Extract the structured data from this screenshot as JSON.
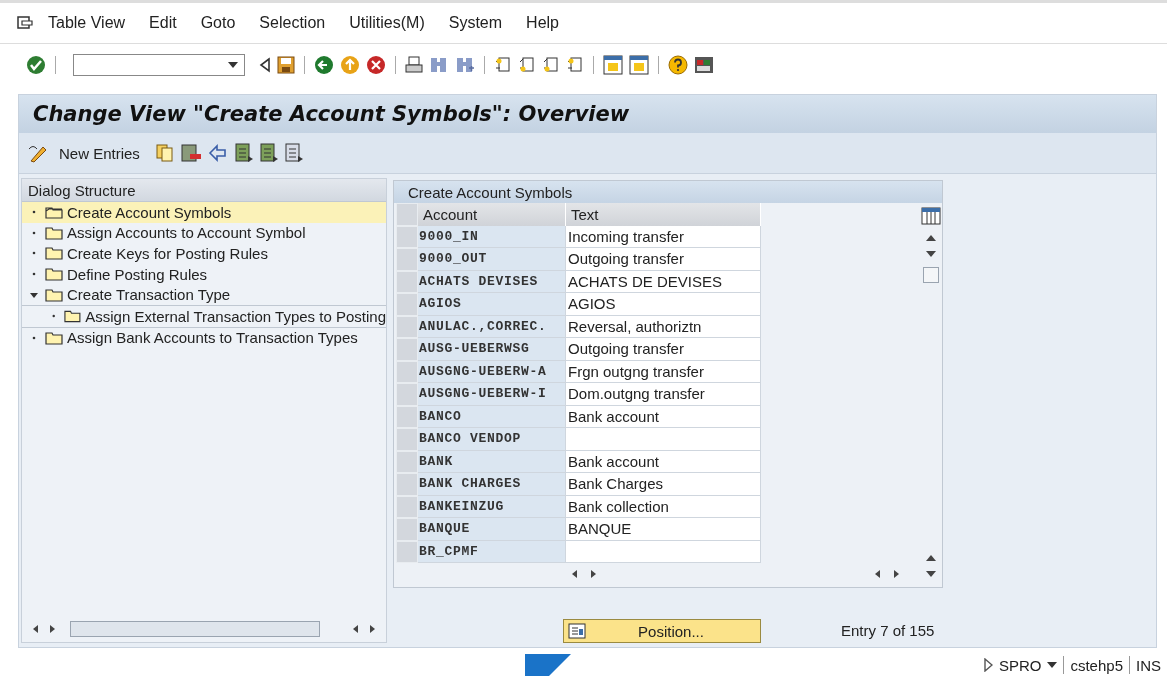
{
  "menu": [
    "Table View",
    "Edit",
    "Goto",
    "Selection",
    "Utilities(M)",
    "System",
    "Help"
  ],
  "title": "Change View \"Create Account Symbols\": Overview",
  "app_toolbar": {
    "new_entries": "New Entries"
  },
  "dialog_structure": {
    "heading": "Dialog Structure",
    "items": [
      {
        "label": "Create Account Symbols",
        "selected": true,
        "expanded": false
      },
      {
        "label": "Assign Accounts to Account Symbol",
        "selected": false,
        "expanded": false
      },
      {
        "label": "Create Keys for Posting Rules",
        "selected": false,
        "expanded": false
      },
      {
        "label": "Define Posting Rules",
        "selected": false,
        "expanded": false
      },
      {
        "label": "Create Transaction Type",
        "selected": false,
        "expanded": true,
        "children": [
          {
            "label": "Assign External Transaction Types to Posting",
            "selected": false,
            "expanded": false
          }
        ]
      },
      {
        "label": "Assign Bank Accounts to Transaction Types",
        "selected": false,
        "expanded": false
      }
    ]
  },
  "table": {
    "title": "Create Account Symbols",
    "columns": [
      "Account",
      "Text"
    ],
    "rows": [
      {
        "account": "9000_IN",
        "text": "Incoming transfer"
      },
      {
        "account": "9000_OUT",
        "text": "Outgoing transfer"
      },
      {
        "account": "ACHATS DEVISES",
        "text": "ACHATS DE DEVISES"
      },
      {
        "account": "AGIOS",
        "text": "AGIOS"
      },
      {
        "account": "ANULAC.,CORREC.",
        "text": "Reversal, authoriztn"
      },
      {
        "account": "AUSG-UEBERWSG",
        "text": "Outgoing transfer"
      },
      {
        "account": "AUSGNG-UEBERW-A",
        "text": "Frgn outgng transfer"
      },
      {
        "account": "AUSGNG-UEBERW-I",
        "text": "Dom.outgng transfer"
      },
      {
        "account": "BANCO",
        "text": "Bank account"
      },
      {
        "account": "BANCO VENDOP"
      },
      {
        "account": "BANK",
        "text": "Bank account"
      },
      {
        "account": "BANK CHARGES",
        "text": "Bank Charges"
      },
      {
        "account": "BANKEINZUG",
        "text": "Bank collection"
      },
      {
        "account": "BANQUE",
        "text": "BANQUE"
      },
      {
        "account": "BR_CPMF"
      }
    ]
  },
  "position_button": "Position...",
  "entry_info": "Entry 7 of 155",
  "status_bar": {
    "transaction": "SPRO",
    "server": "cstehp5",
    "mode": "INS"
  }
}
